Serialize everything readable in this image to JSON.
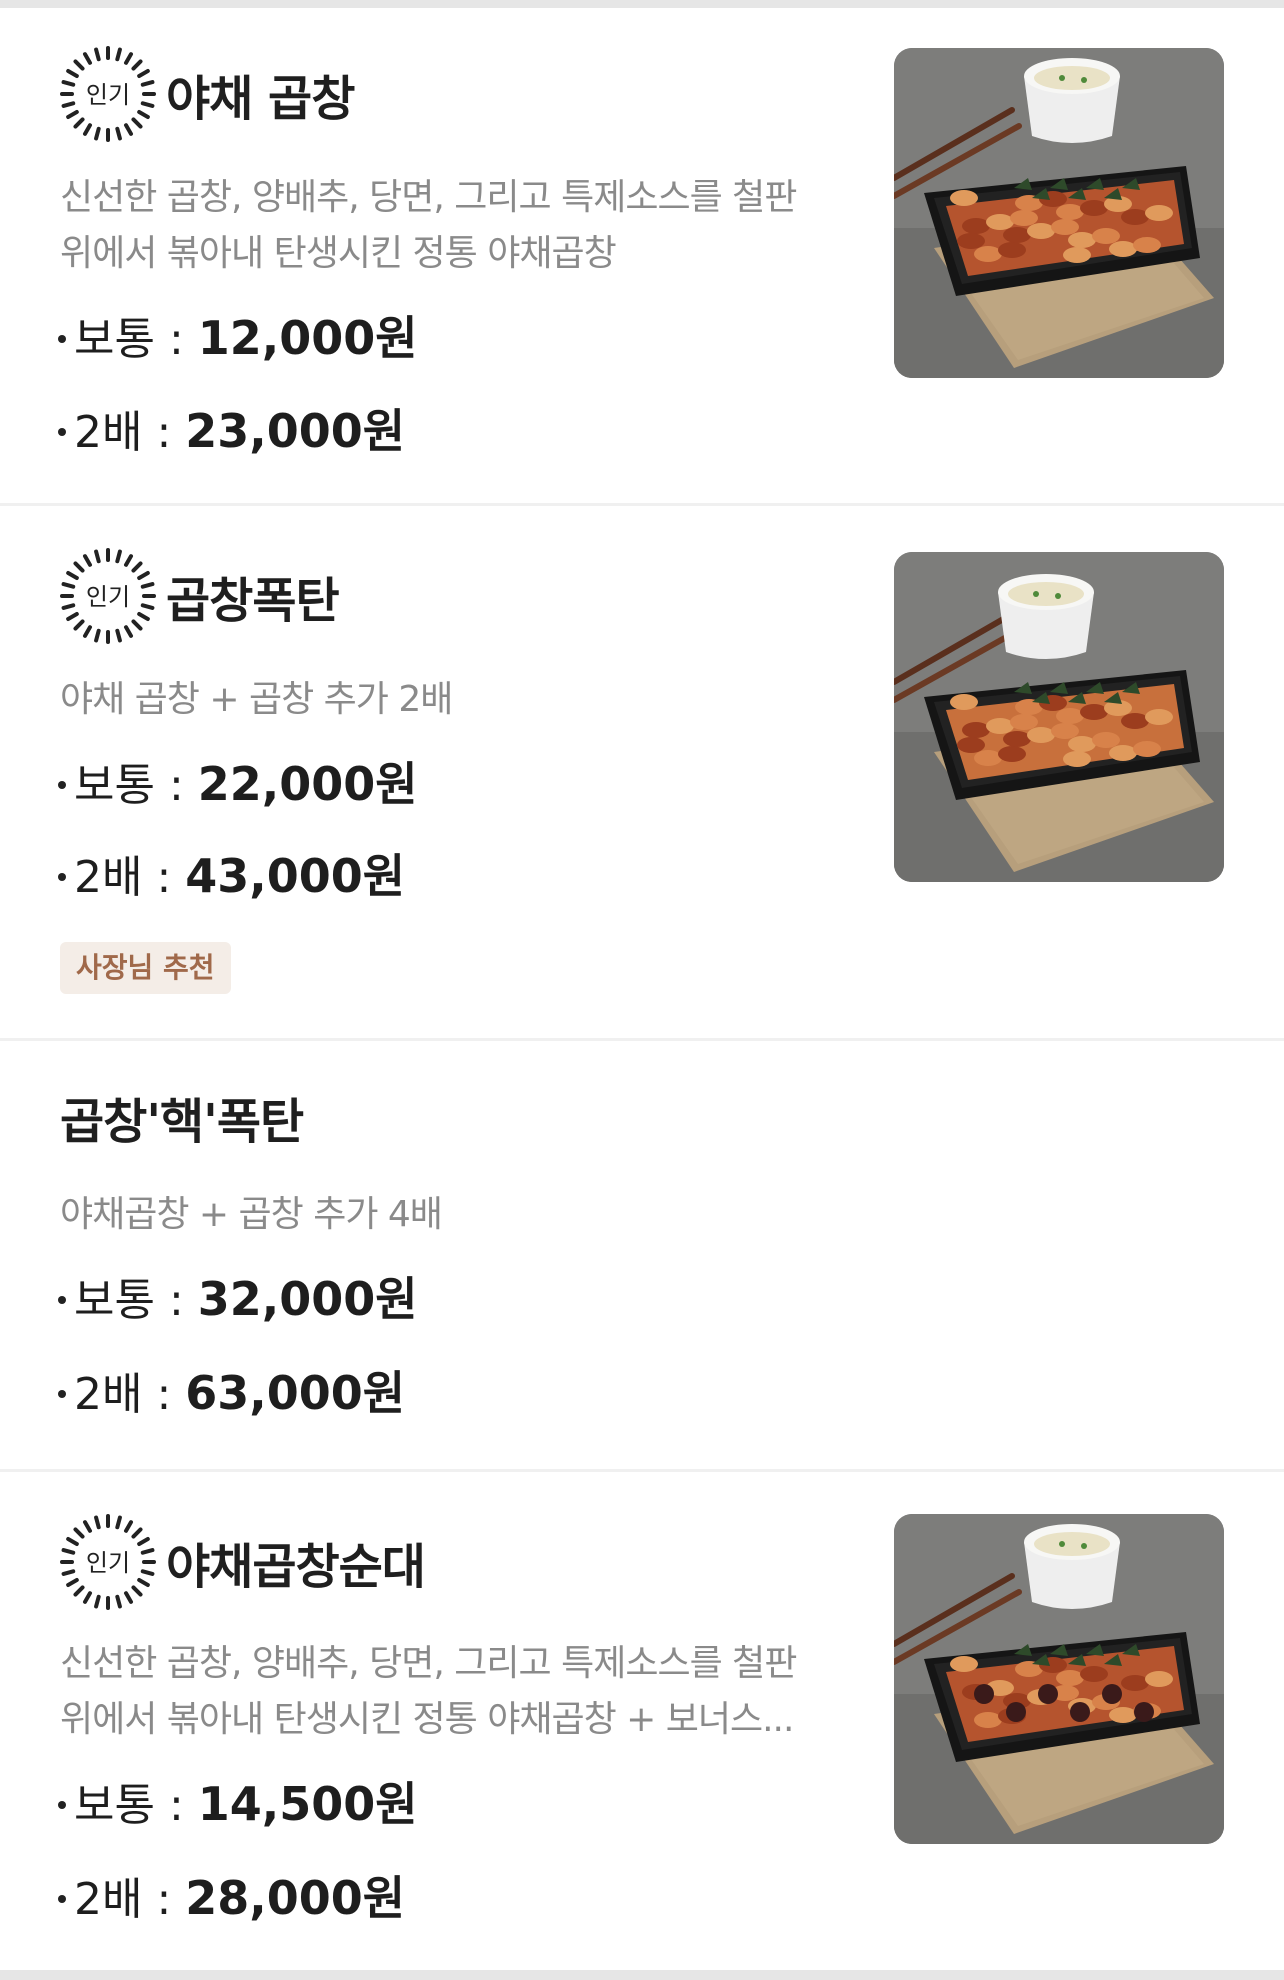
{
  "popular_badge": {
    "label": "인기",
    "icon": "popular-badge-icon"
  },
  "items": [
    {
      "name": "야채 곱창",
      "popular": true,
      "description_lines": [
        "신선한 곱창, 양배추, 당면, 그리고 특제소스를 철판",
        "위에서 볶아내 탄생시킨 정통 야채곱창"
      ],
      "prices": [
        {
          "label": "보통 :",
          "amount": "12,000원"
        },
        {
          "label": "2배 :",
          "amount": "23,000원"
        }
      ],
      "photo": "food-photo-yachae-gopchang"
    },
    {
      "name": "곱창폭탄",
      "popular": true,
      "description_lines": [
        "야채 곱창 + 곱창 추가 2배"
      ],
      "prices": [
        {
          "label": "보통 :",
          "amount": "22,000원"
        },
        {
          "label": "2배 :",
          "amount": "43,000원"
        }
      ],
      "tag": "사장님 추천",
      "photo": "food-photo-gopchang-poktan"
    },
    {
      "name": "곱창'핵'폭탄",
      "popular": false,
      "description_lines": [
        "야채곱창 + 곱창 추가 4배"
      ],
      "prices": [
        {
          "label": "보통 :",
          "amount": "32,000원"
        },
        {
          "label": "2배 :",
          "amount": "63,000원"
        }
      ]
    },
    {
      "name": "야채곱창순대",
      "popular": true,
      "description_lines": [
        "신선한 곱창, 양배추, 당면, 그리고 특제소스를 철판",
        "위에서 볶아내 탄생시킨 정통 야채곱창 + 보너스..."
      ],
      "prices": [
        {
          "label": "보통 :",
          "amount": "14,500원"
        },
        {
          "label": "2배 :",
          "amount": "28,000원"
        }
      ],
      "photo": "food-photo-yachae-gopchang-sundae"
    }
  ],
  "colors": {
    "text": "#1e1e1e",
    "description": "#8a8a8a",
    "tag_bg": "#f4ede7",
    "tag_text": "#a0694a",
    "divider": "#f0f0f0"
  }
}
